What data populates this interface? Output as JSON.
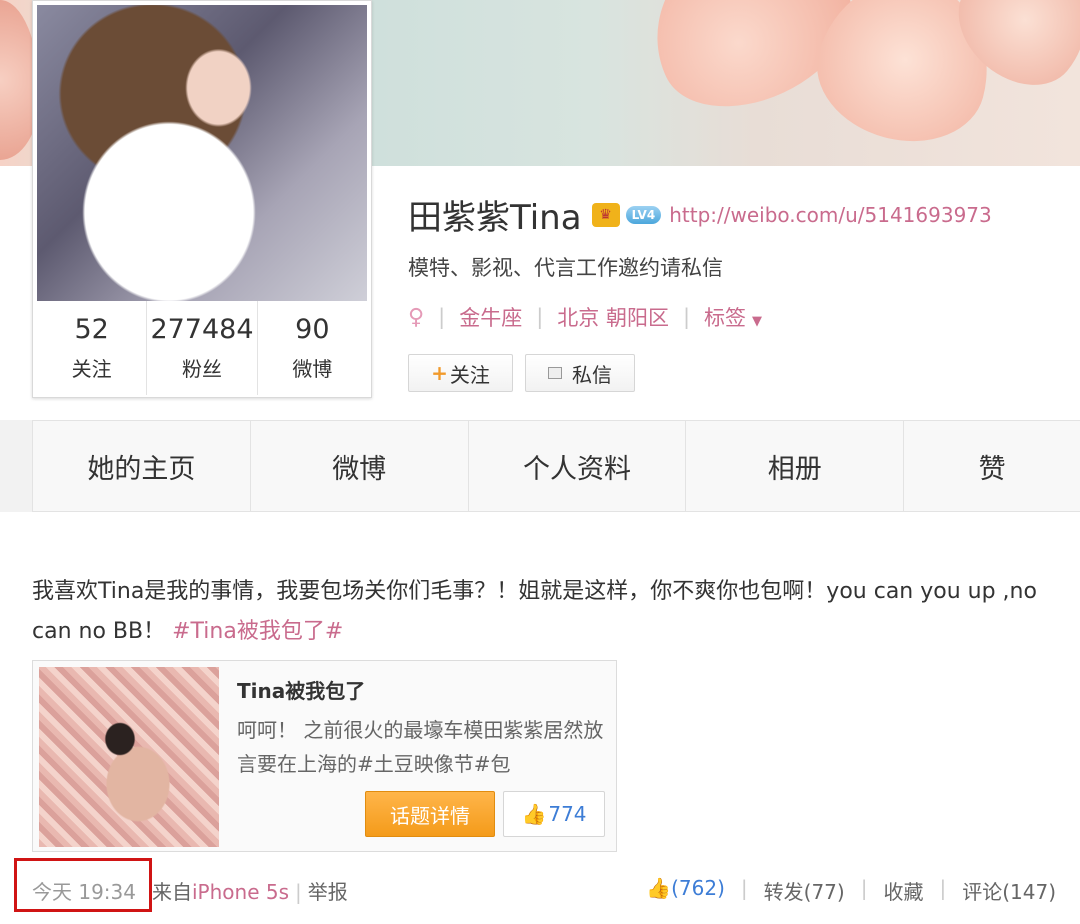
{
  "profile": {
    "name": "田紫紫Tina",
    "vip_icon": "vip-crown-icon",
    "level": "LV4",
    "url": "http://weibo.com/u/5141693973",
    "bio": "模特、影视、代言工作邀约请私信",
    "gender_icon": "female-icon",
    "zodiac": "金牛座",
    "location": "北京 朝阳区",
    "tags_label": "标签",
    "follow_label": "关注",
    "message_label": "私信"
  },
  "stats": [
    {
      "value": "52",
      "label": "关注"
    },
    {
      "value": "277484",
      "label": "粉丝"
    },
    {
      "value": "90",
      "label": "微博"
    }
  ],
  "tabs": [
    "她的主页",
    "微博",
    "个人资料",
    "相册",
    "赞"
  ],
  "post": {
    "text_main": "我喜欢Tina是我的事情，我要包场关你们毛事？！姐就是这样，你不爽你也包啊！you can you up ,no can no BB！",
    "hashtag": "#Tina被我包了#",
    "card": {
      "title": "Tina被我包了",
      "desc": "呵呵！ 之前很火的最壕车模田紫紫居然放言要在上海的#土豆映像节#包",
      "topic_button": "话题详情",
      "like_count": "774"
    },
    "timestamp": "今天 19:34",
    "source_prefix": "来自",
    "source_device": "iPhone 5s",
    "report_label": "举报",
    "likes": "(762)",
    "repost": "转发(77)",
    "favorite": "收藏",
    "comments": "评论(147)"
  },
  "colors": {
    "link_pink": "#c96b8d",
    "highlight_red": "#d01414",
    "button_orange": "#f49b1a",
    "like_blue": "#3d7dd6"
  }
}
